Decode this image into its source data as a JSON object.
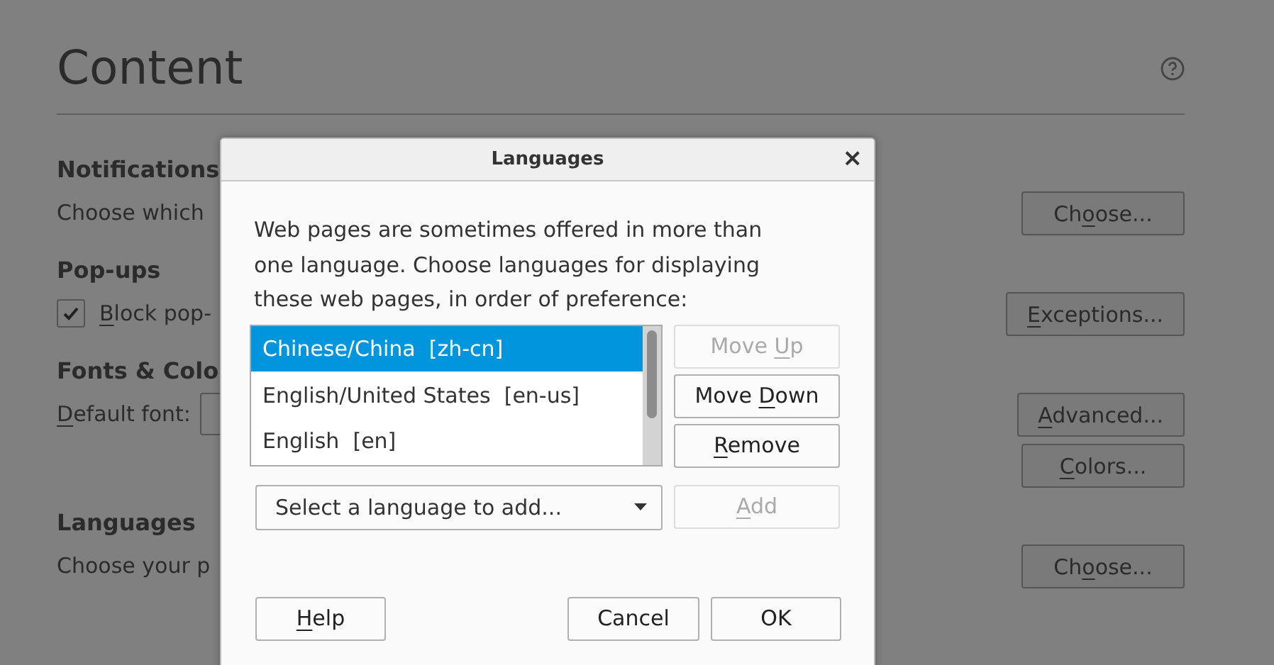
{
  "page": {
    "title": "Content",
    "sections": [
      {
        "heading": "Notifications",
        "rows": [
          {
            "kind": "text",
            "text": "Choose which",
            "buttons": [
              {
                "pre": "Ch",
                "key": "o",
                "post": "ose..."
              }
            ]
          }
        ]
      },
      {
        "heading": "Pop-ups",
        "rows": [
          {
            "kind": "checkbox",
            "checked": true,
            "label": {
              "key": "B",
              "post": "lock pop-"
            },
            "buttons": [
              {
                "key": "E",
                "post": "xceptions..."
              }
            ]
          }
        ]
      },
      {
        "heading": "Fonts & Colo",
        "rows": [
          {
            "kind": "font",
            "label": {
              "key": "D",
              "post": "efault font:"
            },
            "buttons": [
              {
                "key": "A",
                "post": "dvanced..."
              },
              {
                "key": "C",
                "post": "olors..."
              }
            ]
          }
        ]
      },
      {
        "heading": "Languages",
        "rows": [
          {
            "kind": "text",
            "text": "Choose your p",
            "buttons": [
              {
                "pre": "Ch",
                "key": "o",
                "post": "ose..."
              }
            ]
          }
        ]
      }
    ]
  },
  "dialog": {
    "title": "Languages",
    "close": "×",
    "description": "Web pages are sometimes offered in more than one language. Choose languages for displaying these web pages, in order of preference:",
    "languages": [
      {
        "name": "Chinese/China",
        "code": "[zh-cn]",
        "selected": true
      },
      {
        "name": "English/United States",
        "code": "[en-us]",
        "selected": false
      },
      {
        "name": "English",
        "code": "[en]",
        "selected": false
      }
    ],
    "list_buttons": [
      {
        "pre": "Move ",
        "key": "U",
        "post": "p",
        "disabled": true
      },
      {
        "pre": "Move ",
        "key": "D",
        "post": "own",
        "disabled": false
      },
      {
        "key": "R",
        "post": "emove",
        "disabled": false
      }
    ],
    "language_select": {
      "placeholder": "Select a language to add..."
    },
    "add_button": {
      "key": "A",
      "post": "dd",
      "disabled": true
    },
    "footer_buttons": [
      {
        "key": "H",
        "post": "elp",
        "disabled": false
      },
      {
        "pre": "Cancel",
        "disabled": false
      },
      {
        "pre": "OK",
        "disabled": false
      }
    ]
  }
}
